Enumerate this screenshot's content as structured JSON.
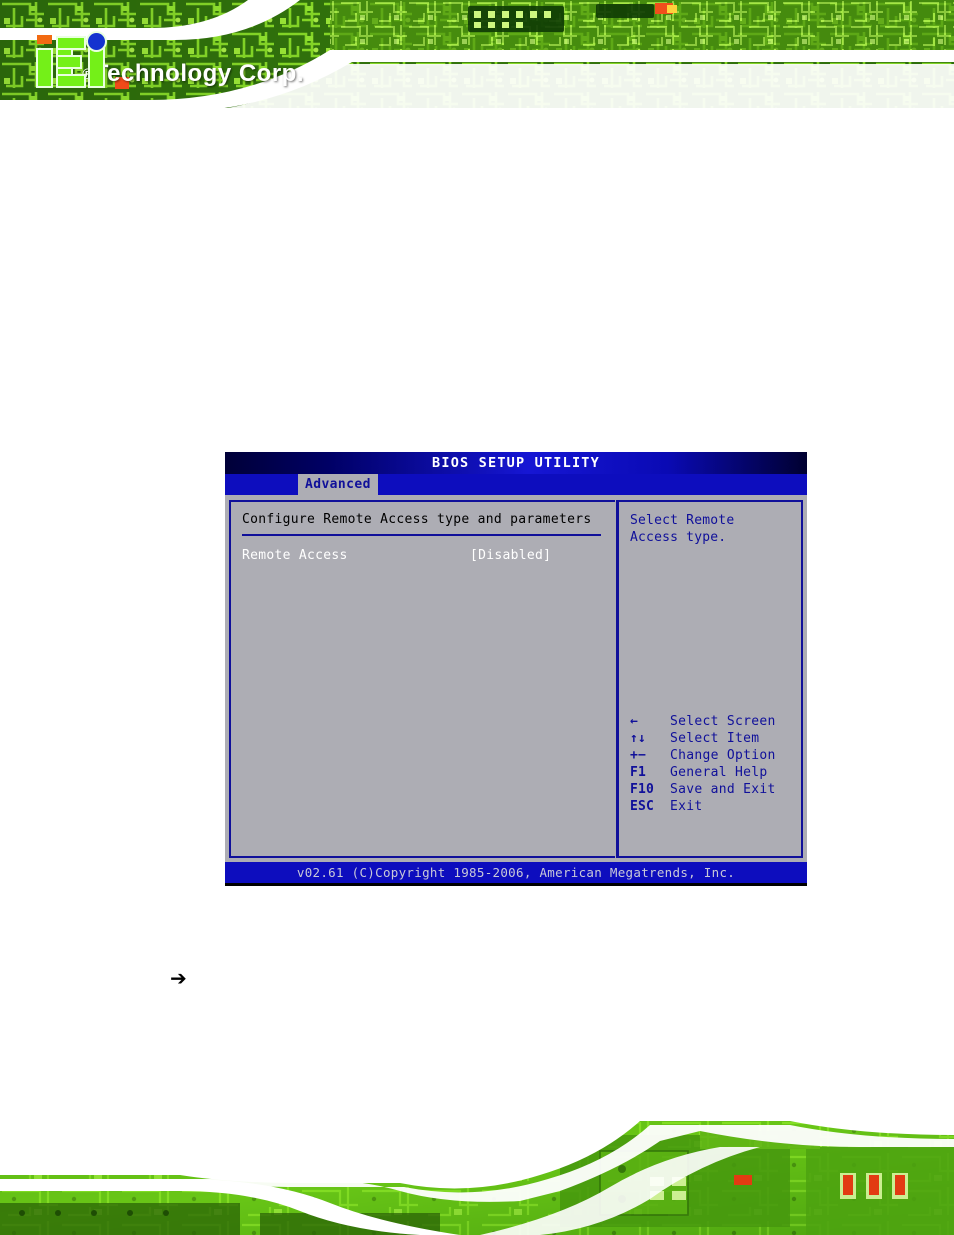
{
  "header": {
    "logo_letters": "iEi",
    "logo_text": "Technology Corp.",
    "registered_mark": "®"
  },
  "marker": {
    "glyph": "➔"
  },
  "bios": {
    "title": "BIOS SETUP UTILITY",
    "active_tab": "Advanced",
    "section_heading": "Configure Remote Access type and parameters",
    "options": [
      {
        "label": "Remote Access",
        "value": "[Disabled]"
      }
    ],
    "help_text": "Select Remote Access type.",
    "key_legend": [
      {
        "key": "←",
        "desc": "Select Screen"
      },
      {
        "key": "↑↓",
        "desc": "Select Item"
      },
      {
        "key": "+−",
        "desc": "Change Option"
      },
      {
        "key": "F1",
        "desc": "General Help"
      },
      {
        "key": "F10",
        "desc": "Save and Exit"
      },
      {
        "key": "ESC",
        "desc": "Exit"
      }
    ],
    "footer": "v02.61 (C)Copyright 1985-2006, American Megatrends, Inc."
  },
  "colors": {
    "bios_blue": "#0d0dbe",
    "bios_gray": "#adadb4",
    "bios_dark_blue": "#10109a",
    "pcb_green": "#7ed321",
    "accent_orange": "#f26a12",
    "accent_blue": "#1433cf"
  }
}
